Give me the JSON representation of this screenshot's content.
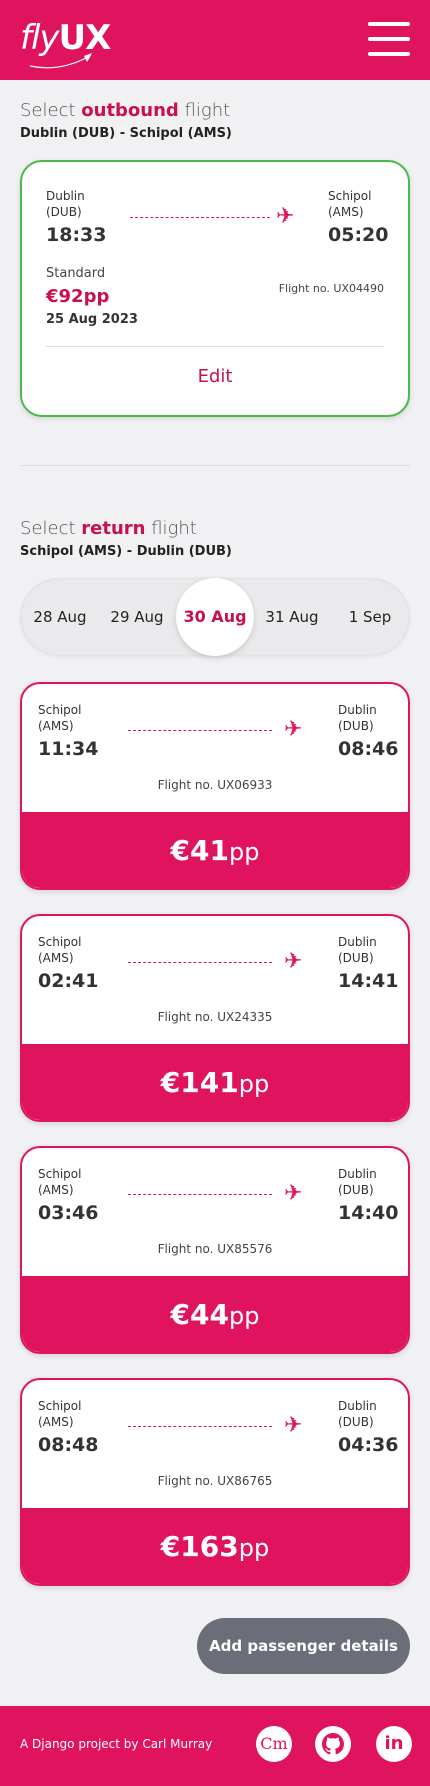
{
  "header": {
    "logo_fly": "fly",
    "logo_ux": "UX",
    "menu_icon": "hamburger-menu-icon"
  },
  "outbound": {
    "title_prefix": "Select ",
    "title_emph": "outbound",
    "title_suffix": " flight",
    "route": "Dublin (DUB) - Schipol (AMS)",
    "selected": {
      "from_city": "Dublin",
      "from_code": "(DUB)",
      "dep_time": "18:33",
      "to_city": "Schipol",
      "to_code": "(AMS)",
      "arr_time": "05:20",
      "tier": "Standard",
      "price": "€92pp",
      "date": "25 Aug 2023",
      "flight_no": "Flight no. UX04490",
      "edit_label": "Edit"
    }
  },
  "return": {
    "title_prefix": "Select ",
    "title_emph": "return",
    "title_suffix": " flight",
    "route": "Schipol (AMS) - Dublin (DUB)",
    "dates": [
      "28 Aug",
      "29 Aug",
      "30 Aug",
      "31 Aug",
      "1 Sep"
    ],
    "active_date": "30 Aug",
    "flights": [
      {
        "from_city": "Schipol",
        "from_code": "(AMS)",
        "dep_time": "11:34",
        "to_city": "Dublin",
        "to_code": "(DUB)",
        "arr_time": "08:46",
        "flight_no": "Flight no. UX06933",
        "price": "€41",
        "pp": "pp"
      },
      {
        "from_city": "Schipol",
        "from_code": "(AMS)",
        "dep_time": "02:41",
        "to_city": "Dublin",
        "to_code": "(DUB)",
        "arr_time": "14:41",
        "flight_no": "Flight no. UX24335",
        "price": "€141",
        "pp": "pp"
      },
      {
        "from_city": "Schipol",
        "from_code": "(AMS)",
        "dep_time": "03:46",
        "to_city": "Dublin",
        "to_code": "(DUB)",
        "arr_time": "14:40",
        "flight_no": "Flight no. UX85576",
        "price": "€44",
        "pp": "pp"
      },
      {
        "from_city": "Schipol",
        "from_code": "(AMS)",
        "dep_time": "08:48",
        "to_city": "Dublin",
        "to_code": "(DUB)",
        "arr_time": "04:36",
        "flight_no": "Flight no. UX86765",
        "price": "€163",
        "pp": "pp"
      }
    ]
  },
  "cta": {
    "label": "Add passenger details"
  },
  "footer": {
    "text_prefix": "A Django project by ",
    "author": "Carl Murray",
    "cm_label": "Cm",
    "linkedin_label": "in"
  },
  "colors": {
    "brand": "#e0135f",
    "selected_border": "#4cb848",
    "cta_bg": "#6b6e78"
  }
}
